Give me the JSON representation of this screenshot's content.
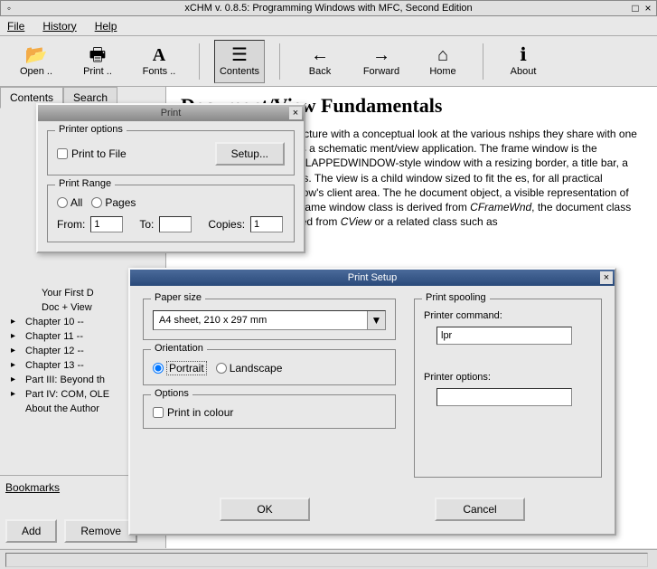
{
  "window": {
    "title": "xCHM v. 0.8.5: Programming Windows with MFC, Second Edition"
  },
  "menu": {
    "file": "File",
    "history": "History",
    "help": "Help"
  },
  "toolbar": {
    "open": "Open ..",
    "print": "Print ..",
    "fonts": "Fonts ..",
    "contents": "Contents",
    "back": "Back",
    "forward": "Forward",
    "home": "Home",
    "about": "About"
  },
  "sidebar": {
    "tabs": {
      "contents": "Contents",
      "search": "Search"
    },
    "items": [
      "Your First D",
      "Doc + View",
      "Chapter 10 --",
      "Chapter 11 --",
      "Chapter 12 --",
      "Chapter 13 --",
      "Part III: Beyond th",
      "Part IV: COM, OLE",
      "About the Author"
    ],
    "bookmarks": "Bookmarks",
    "add": "Add",
    "remove": "Remove"
  },
  "content": {
    "heading": "Document/View Fundamentals",
    "para_prefix": "he document/view architecture with a conceptual look at the various nships they share with one another. Figure 9-1 shows a schematic ment/view application. The frame window is the application's top-level /ERLAPPEDWINDOW-style window with a resizing border, a title bar, a aximize, and close buttons. The view is a child window sized to fit the es, for all practical purposes, the frame window's client area. The he document object, a visible representation of which appears in the he frame window class is derived from ",
    "em1": "CFrameWnd",
    "mid": ", the document class nd the view class is derived from ",
    "em2": "CView",
    "suffix": " or a related class such as"
  },
  "print": {
    "title": "Print",
    "printer_options": "Printer options",
    "print_to_file": "Print to File",
    "setup": "Setup...",
    "print_range": "Print Range",
    "all": "All",
    "pages": "Pages",
    "from": "From:",
    "from_val": "1",
    "to": "To:",
    "to_val": "",
    "copies": "Copies:",
    "copies_val": "1"
  },
  "setup": {
    "title": "Print Setup",
    "paper_size": "Paper size",
    "paper_val": "A4 sheet, 210 x 297 mm",
    "orientation": "Orientation",
    "portrait": "Portrait",
    "landscape": "Landscape",
    "options": "Options",
    "colour": "Print in colour",
    "spooling": "Print spooling",
    "printer_command": "Printer command:",
    "cmd_val": "lpr",
    "printer_options": "Printer options:",
    "opts_val": "",
    "ok": "OK",
    "cancel": "Cancel"
  }
}
